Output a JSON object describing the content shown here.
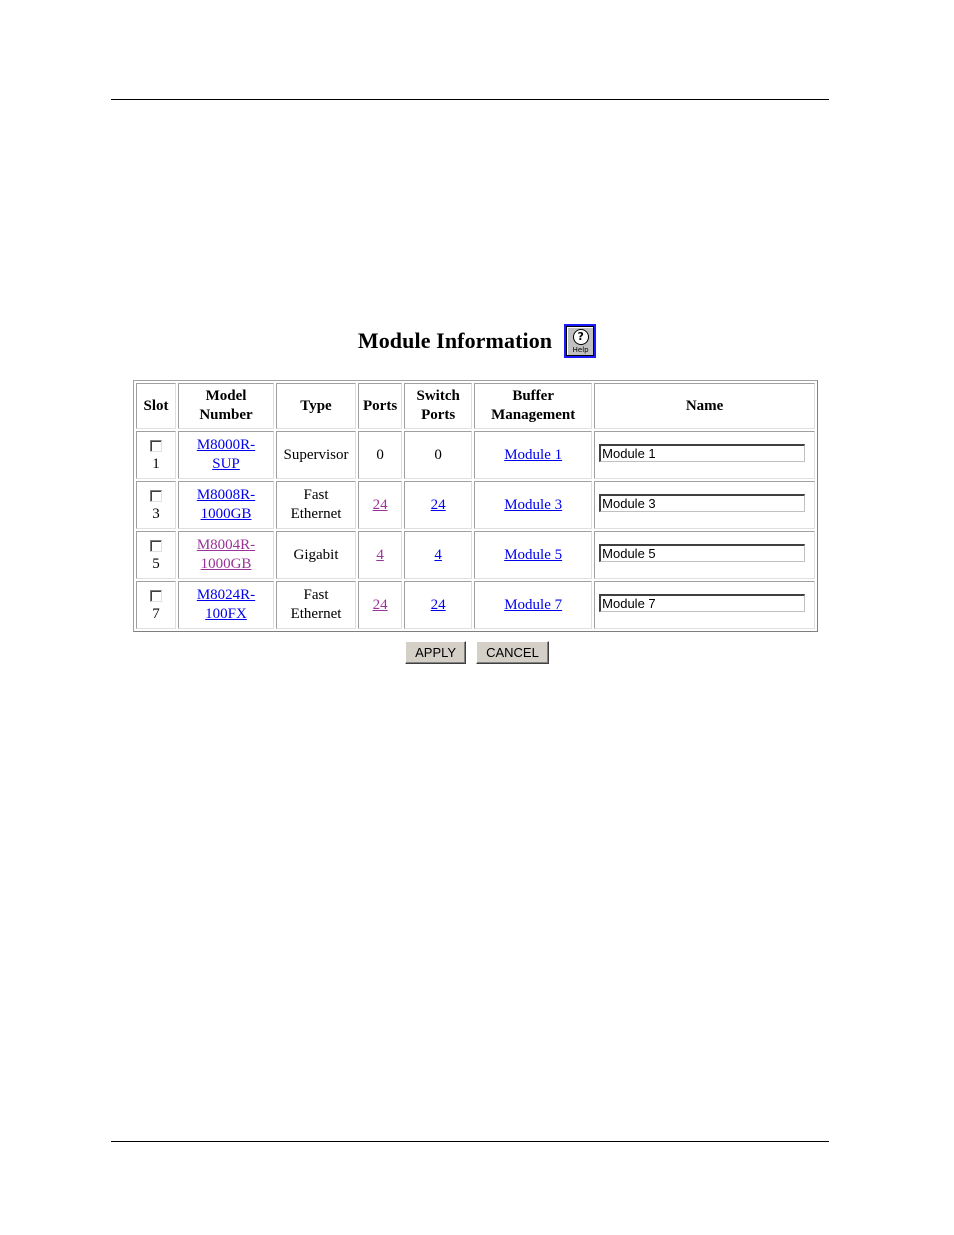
{
  "page": {
    "title": "Module Information",
    "help_icon": {
      "name": "help-icon",
      "label": "Help",
      "glyph": "?"
    }
  },
  "table": {
    "headers": [
      "Slot",
      "Model Number",
      "Type",
      "Ports",
      "Switch Ports",
      "Buffer Management",
      "Name"
    ],
    "header_lines": {
      "model": [
        "Model",
        "Number"
      ],
      "switch": [
        "Switch",
        "Ports"
      ],
      "buffer": [
        "Buffer",
        "Management"
      ]
    },
    "rows": [
      {
        "slot": "1",
        "checked": false,
        "model_line1": "M8000R-",
        "model_line2": "SUP",
        "model_visited": false,
        "type_line1": "Supervisor",
        "type_line2": "",
        "ports": "0",
        "ports_link": false,
        "switch_ports": "0",
        "switch_link": false,
        "buffer": "Module 1",
        "name": "Module 1"
      },
      {
        "slot": "3",
        "checked": false,
        "model_line1": "M8008R-",
        "model_line2": "1000GB",
        "model_visited": false,
        "type_line1": "Fast",
        "type_line2": "Ethernet",
        "ports": "24",
        "ports_link": true,
        "switch_ports": "24",
        "switch_link": true,
        "buffer": "Module 3",
        "name": "Module 3"
      },
      {
        "slot": "5",
        "checked": false,
        "model_line1": "M8004R-",
        "model_line2": "1000GB",
        "model_visited": true,
        "type_line1": "Gigabit",
        "type_line2": "",
        "ports": "4",
        "ports_link": true,
        "switch_ports": "4",
        "switch_link": true,
        "buffer": "Module 5",
        "name": "Module 5"
      },
      {
        "slot": "7",
        "checked": false,
        "model_line1": "M8024R-",
        "model_line2": "100FX",
        "model_visited": false,
        "type_line1": "Fast",
        "type_line2": "Ethernet",
        "ports": "24",
        "ports_link": true,
        "switch_ports": "24",
        "switch_link": true,
        "buffer": "Module 7",
        "name": "Module 7"
      }
    ]
  },
  "buttons": {
    "apply": "APPLY",
    "cancel": "CANCEL"
  },
  "colors": {
    "link": "#0000ee",
    "visited_link": "#993399",
    "button_face": "#d4d0c8",
    "help_border": "#1a1aff"
  }
}
